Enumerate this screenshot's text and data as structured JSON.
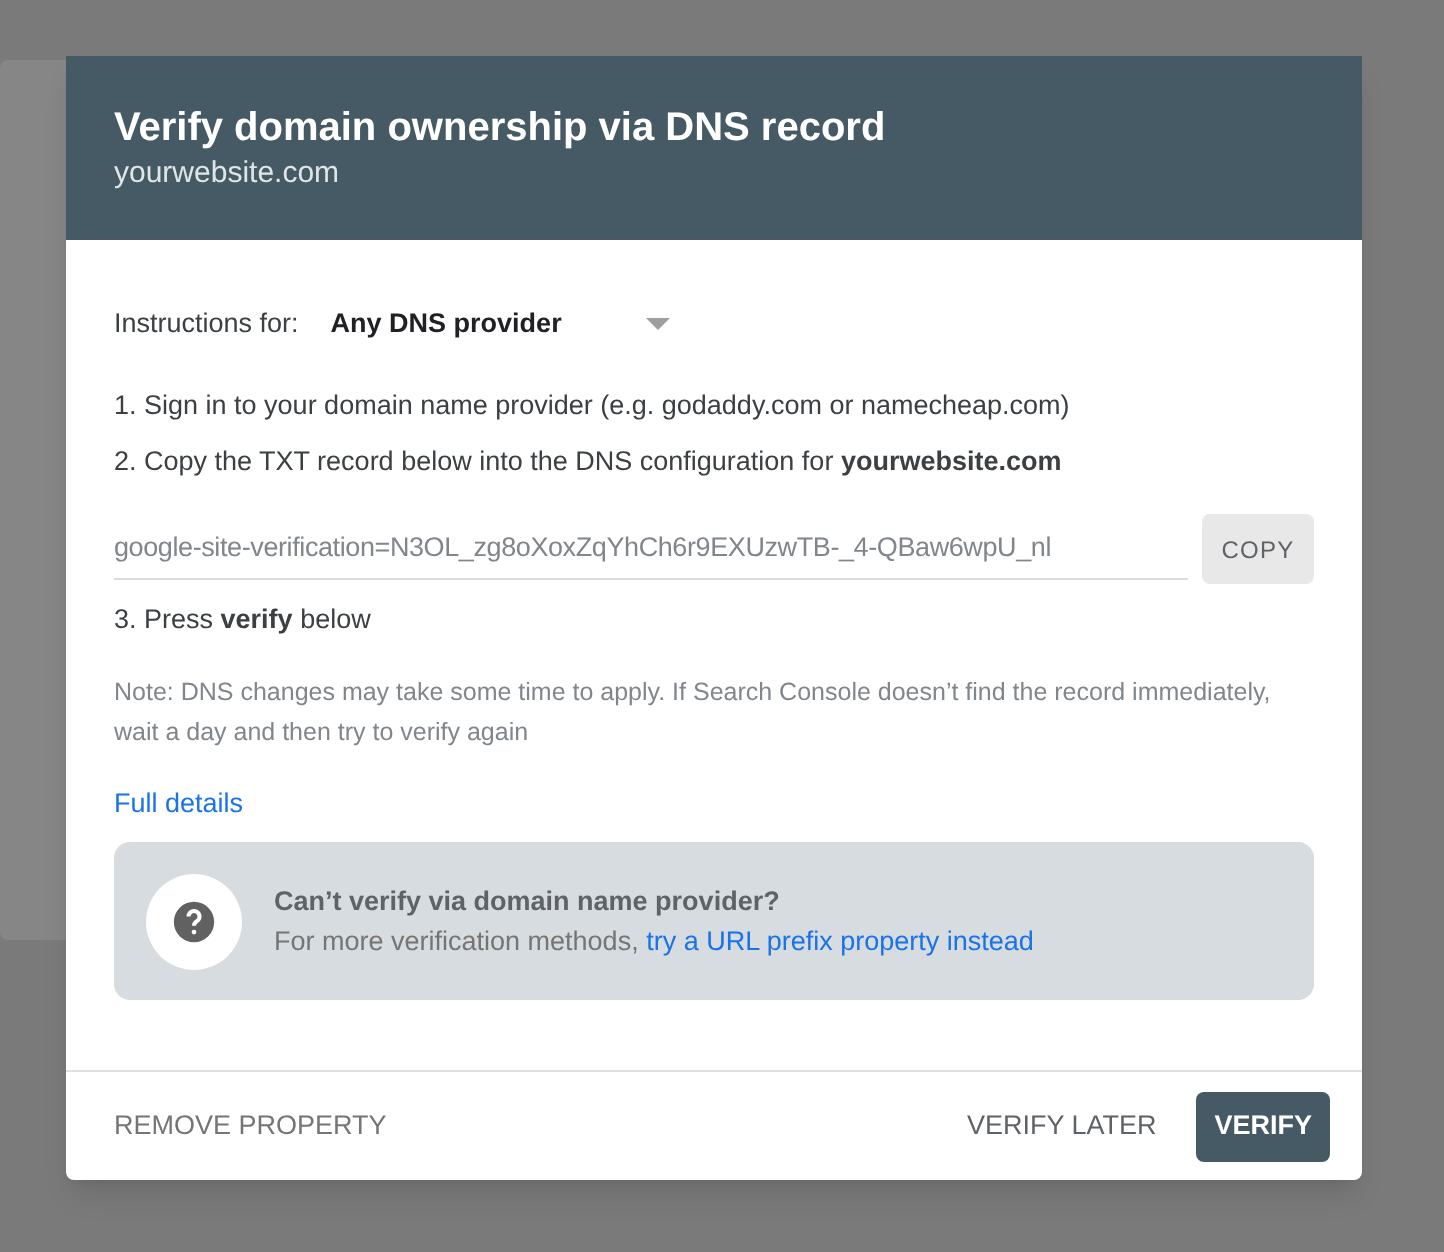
{
  "dialog": {
    "title": "Verify domain ownership via DNS record",
    "subtitle": "yourwebsite.com"
  },
  "instructions": {
    "label": "Instructions for:",
    "value": "Any DNS provider"
  },
  "steps": [
    "1. Sign in to your domain name provider (e.g. godaddy.com or namecheap.com)",
    "2. Copy the TXT record below into the DNS configuration for **yourwebsite.com**"
  ],
  "txt_record": {
    "value": "google-site-verification=N3OL_zg8oXoxZqYhCh6r9EXUzwTB-_4-QBaw6wpU_nl",
    "copy_button": "COPY"
  },
  "step_3": "3. Press **verify** below",
  "note": "Note: DNS changes may take some time to apply. If Search Console doesn’t find the record immediately, wait a day and then try to verify again",
  "full_details_link": "Full details",
  "help_box": {
    "title": "Can’t verify via domain name provider?",
    "text": "For more verification methods,",
    "link": "try a URL prefix property instead"
  },
  "footer": {
    "remove_button": "REMOVE PROPERTY",
    "buttons": [
      {
        "label": "VERIFY LATER",
        "kind": "text"
      },
      {
        "label": "VERIFY",
        "kind": "filled"
      }
    ]
  }
}
